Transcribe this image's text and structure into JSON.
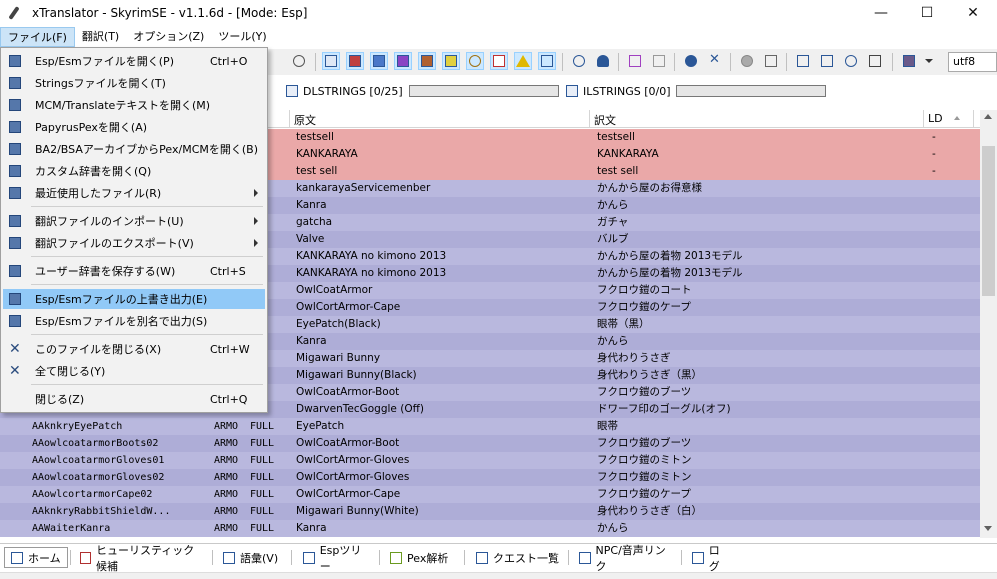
{
  "window": {
    "title": "xTranslator - SkyrimSE - v1.1.6d - [Mode: Esp]",
    "minimize_glyph": "—",
    "maximize_glyph": "☐",
    "close_glyph": "✕"
  },
  "menubar": {
    "items": [
      "ファイル(F)",
      "翻訳(T)",
      "オプション(Z)",
      "ツール(Y)"
    ]
  },
  "toolbar": {
    "encoding": "utf8"
  },
  "progress": {
    "dlstrings": "DLSTRINGS [0/25]",
    "ilstrings": "ILSTRINGS [0/0]"
  },
  "grid": {
    "headers": {
      "source": "原文",
      "translation": "訳文",
      "ld": "LD"
    },
    "rows": [
      {
        "edid": "",
        "rec": "",
        "field": "",
        "source": "testsell",
        "dest": "testsell",
        "ld": "-",
        "style": "red"
      },
      {
        "edid": "",
        "rec": "",
        "field": "",
        "source": "KANKARAYA",
        "dest": "KANKARAYA",
        "ld": "-",
        "style": "red"
      },
      {
        "edid": "",
        "rec": "",
        "field": "",
        "source": "test sell",
        "dest": "test sell",
        "ld": "-",
        "style": "red"
      },
      {
        "edid": "",
        "rec": "",
        "field": "",
        "source": "kankarayaServicemenber",
        "dest": "かんから屋のお得意様",
        "ld": "",
        "style": "purple"
      },
      {
        "edid": "",
        "rec": "",
        "field": "",
        "source": "Kanra",
        "dest": "かんら",
        "ld": "",
        "style": "purple2"
      },
      {
        "edid": "",
        "rec": "",
        "field": "",
        "source": "gatcha",
        "dest": "ガチャ",
        "ld": "",
        "style": "purple"
      },
      {
        "edid": "",
        "rec": "",
        "field": "",
        "source": "Valve",
        "dest": "バルブ",
        "ld": "",
        "style": "purple2"
      },
      {
        "edid": "",
        "rec": "",
        "field": "",
        "source": "KANKARAYA no kimono 2013",
        "dest": "かんから屋の着物 2013モデル",
        "ld": "",
        "style": "purple"
      },
      {
        "edid": "",
        "rec": "",
        "field": "",
        "source": "KANKARAYA no kimono 2013",
        "dest": "かんから屋の着物 2013モデル",
        "ld": "",
        "style": "purple2"
      },
      {
        "edid": "",
        "rec": "",
        "field": "",
        "source": "OwlCoatArmor",
        "dest": "フクロウ鎧のコート",
        "ld": "",
        "style": "purple"
      },
      {
        "edid": "",
        "rec": "",
        "field": "",
        "source": "OwlCortArmor-Cape",
        "dest": "フクロウ鎧のケープ",
        "ld": "",
        "style": "purple2"
      },
      {
        "edid": "",
        "rec": "",
        "field": "",
        "source": "EyePatch(Black)",
        "dest": "眼帯（黒）",
        "ld": "",
        "style": "purple"
      },
      {
        "edid": "",
        "rec": "",
        "field": "",
        "source": "Kanra",
        "dest": "かんら",
        "ld": "",
        "style": "purple2"
      },
      {
        "edid": "",
        "rec": "",
        "field": "",
        "source": "Migawari Bunny",
        "dest": "身代わりうさぎ",
        "ld": "",
        "style": "purple"
      },
      {
        "edid": "",
        "rec": "",
        "field": "",
        "source": "Migawari Bunny(Black)",
        "dest": "身代わりうさぎ（黒）",
        "ld": "",
        "style": "purple2"
      },
      {
        "edid": "",
        "rec": "",
        "field": "",
        "source": "OwlCoatArmor-Boot",
        "dest": "フクロウ鎧のブーツ",
        "ld": "",
        "style": "purple"
      },
      {
        "edid": "",
        "rec": "",
        "field": "",
        "source": "DwarvenTecGoggle (Off)",
        "dest": "ドワーフ印のゴーグル(オフ)",
        "ld": "",
        "style": "purple2"
      },
      {
        "edid": "AAknkryEyePatch",
        "rec": "ARMO",
        "field": "FULL",
        "source": "EyePatch",
        "dest": "眼帯",
        "ld": "",
        "style": "purple"
      },
      {
        "edid": "AAowlcoatarmorBoots02",
        "rec": "ARMO",
        "field": "FULL",
        "source": "OwlCoatArmor-Boot",
        "dest": "フクロウ鎧のブーツ",
        "ld": "",
        "style": "purple2"
      },
      {
        "edid": "AAowlcoatarmorGloves01",
        "rec": "ARMO",
        "field": "FULL",
        "source": "OwlCortArmor-Gloves",
        "dest": "フクロウ鎧のミトン",
        "ld": "",
        "style": "purple"
      },
      {
        "edid": "AAowlcoatarmorGloves02",
        "rec": "ARMO",
        "field": "FULL",
        "source": "OwlCortArmor-Gloves",
        "dest": "フクロウ鎧のミトン",
        "ld": "",
        "style": "purple2"
      },
      {
        "edid": "AAowlcortarmorCape02",
        "rec": "ARMO",
        "field": "FULL",
        "source": "OwlCortArmor-Cape",
        "dest": "フクロウ鎧のケープ",
        "ld": "",
        "style": "purple"
      },
      {
        "edid": "AAknkryRabbitShieldW...",
        "rec": "ARMO",
        "field": "FULL",
        "source": "Migawari Bunny(White)",
        "dest": "身代わりうさぎ（白）",
        "ld": "",
        "style": "purple2"
      },
      {
        "edid": "AAWaiterKanra",
        "rec": "ARMO",
        "field": "FULL",
        "source": "Kanra",
        "dest": "かんら",
        "ld": "",
        "style": "purple"
      }
    ]
  },
  "tabs": [
    "ホーム",
    "ヒューリスティック候補",
    "語彙(V)",
    "Espツリー",
    "Pex解析",
    "クエスト一覧",
    "NPC/音声リンク",
    "ログ"
  ],
  "file_menu": {
    "items": [
      {
        "label": "Esp/Esmファイルを開く(P)",
        "shortcut": "Ctrl+O"
      },
      {
        "label": "Stringsファイルを開く(T)",
        "shortcut": ""
      },
      {
        "label": "MCM/Translateテキストを開く(M)",
        "shortcut": ""
      },
      {
        "label": "PapyrusPexを開く(A)",
        "shortcut": ""
      },
      {
        "label": "BA2/BSAアーカイブからPex/MCMを開く(B)",
        "shortcut": ""
      },
      {
        "label": "カスタム辞書を開く(Q)",
        "shortcut": ""
      },
      {
        "label": "最近使用したファイル(R)",
        "shortcut": ""
      },
      {
        "label": "翻訳ファイルのインポート(U)",
        "shortcut": ""
      },
      {
        "label": "翻訳ファイルのエクスポート(V)",
        "shortcut": ""
      },
      {
        "label": "ユーザー辞書を保存する(W)",
        "shortcut": "Ctrl+S"
      },
      {
        "label": "Esp/Esmファイルの上書き出力(E)",
        "shortcut": ""
      },
      {
        "label": "Esp/Esmファイルを別名で出力(S)",
        "shortcut": ""
      },
      {
        "label": "このファイルを閉じる(X)",
        "shortcut": "Ctrl+W"
      },
      {
        "label": "全て閉じる(Y)",
        "shortcut": ""
      },
      {
        "label": "閉じる(Z)",
        "shortcut": "Ctrl+Q"
      }
    ]
  },
  "colors": {
    "row_red": "#eaa8a8",
    "row_purple": "#b9b8de",
    "menu_highlight": "#91c9f7"
  }
}
